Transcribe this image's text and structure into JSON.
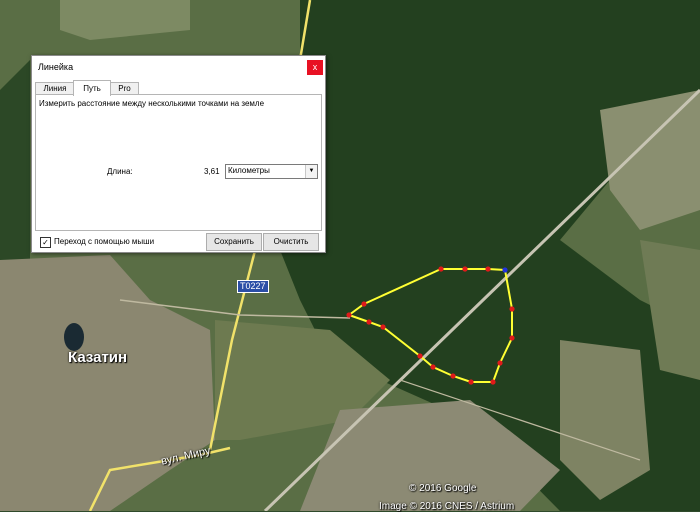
{
  "window": {
    "title": "Линейка",
    "close_label": "x"
  },
  "tabs": [
    {
      "label": "Линия",
      "active": false
    },
    {
      "label": "Путь",
      "active": true
    },
    {
      "label": "Pro",
      "active": false
    }
  ],
  "panel": {
    "description": "Измерить расстояние между несколькими точками на земле",
    "length_label": "Длина:",
    "length_value": "3,61",
    "unit_selected": "Километры"
  },
  "footer": {
    "mouse_nav_label": "Переход с помощью мыши",
    "mouse_nav_checked": true,
    "save_label": "Сохранить",
    "clear_label": "Очистить"
  },
  "map": {
    "city_label": "Казатин",
    "street_label": "вул. Миру",
    "road_badge": "T0227",
    "copyright": "© 2016 Google",
    "imagery_credit": "Image © 2016 CNES / Astrium",
    "path_color": "#ffff33",
    "point_color": "#e01a1a",
    "end_point_color": "#2233dd",
    "forest_color": "#23401f",
    "field_color": "#6b7d55",
    "road_color": "#f1e26a"
  }
}
